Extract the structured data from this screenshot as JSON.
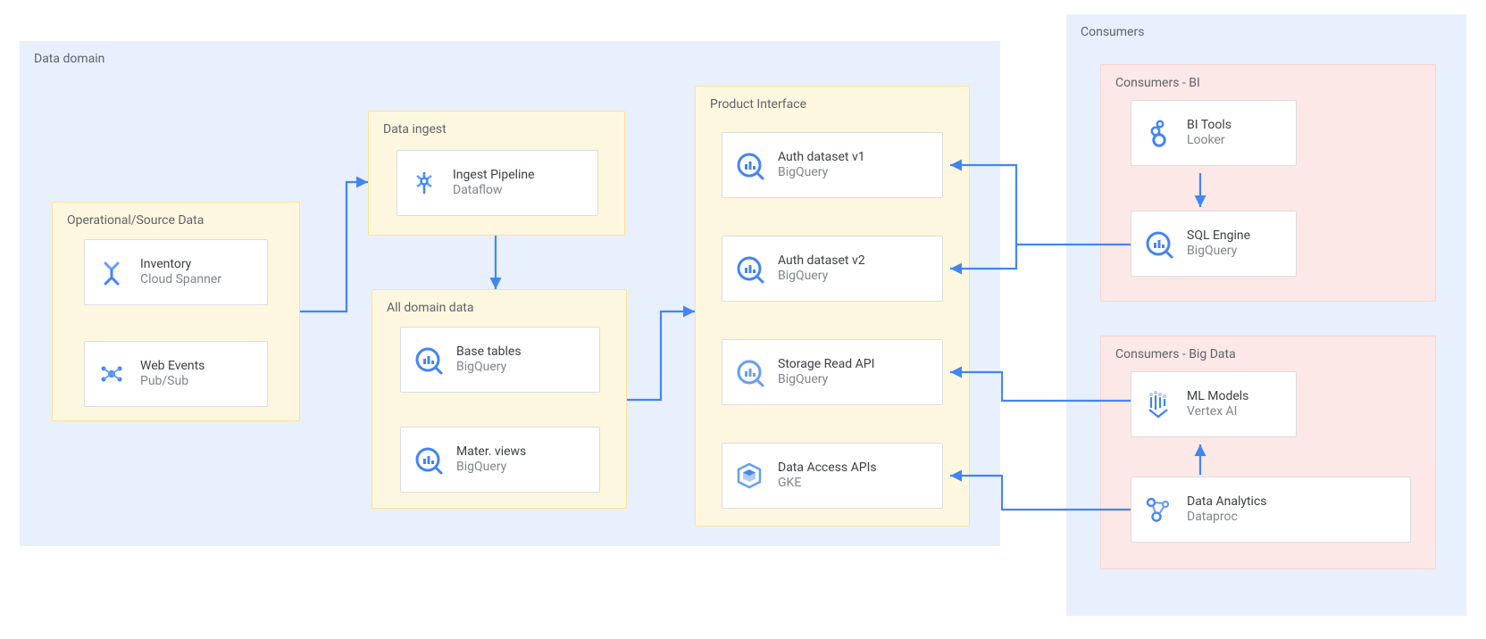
{
  "section": {
    "data_domain": "Data domain",
    "operational": "Operational/Source Data",
    "data_ingest": "Data ingest",
    "all_domain": "All domain data",
    "product_if": "Product Interface",
    "consumers": "Consumers",
    "consumers_bi": "Consumers - BI",
    "consumers_bd": "Consumers - Big Data"
  },
  "card": {
    "inventory": {
      "title": "Inventory",
      "sub": "Cloud Spanner"
    },
    "web_events": {
      "title": "Web Events",
      "sub": "Pub/Sub"
    },
    "ingest": {
      "title": "Ingest Pipeline",
      "sub": "Dataflow"
    },
    "base_tables": {
      "title": "Base tables",
      "sub": "BigQuery"
    },
    "mater_views": {
      "title": "Mater. views",
      "sub": "BigQuery"
    },
    "authv1": {
      "title": "Auth dataset v1",
      "sub": "BigQuery"
    },
    "authv2": {
      "title": "Auth dataset v2",
      "sub": "BigQuery"
    },
    "storage_api": {
      "title": "Storage Read API",
      "sub": "BigQuery"
    },
    "data_access": {
      "title": "Data Access APIs",
      "sub": "GKE"
    },
    "bi_tools": {
      "title": "BI Tools",
      "sub": "Looker"
    },
    "sql_engine": {
      "title": "SQL Engine",
      "sub": "BigQuery"
    },
    "ml_models": {
      "title": "ML Models",
      "sub": "Vertex AI"
    },
    "data_analytics": {
      "title": "Data Analytics",
      "sub": "Dataproc"
    }
  }
}
